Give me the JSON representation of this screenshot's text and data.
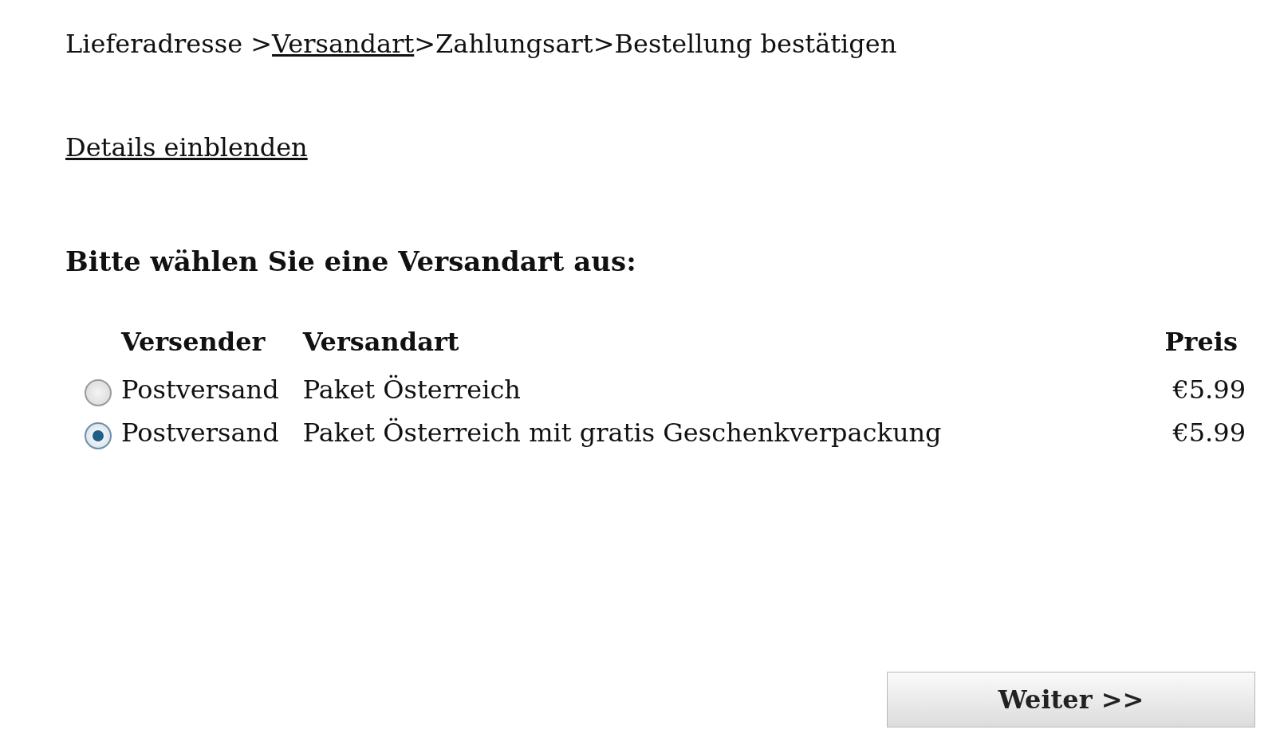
{
  "breadcrumb": [
    {
      "kind": "step",
      "label": "Lieferadresse",
      "selected": false
    },
    {
      "kind": "separator",
      "label": " >"
    },
    {
      "kind": "step",
      "label": "Versandart",
      "selected": true
    },
    {
      "kind": "separator",
      "label": ">"
    },
    {
      "kind": "step",
      "label": "Zahlungsart",
      "selected": false
    },
    {
      "kind": "separator",
      "label": ">"
    },
    {
      "kind": "step",
      "label": "Bestellung bestätigen",
      "selected": false
    }
  ],
  "details_link": "Details einblenden",
  "heading": "Bitte wählen Sie eine Versandart aus:",
  "table": {
    "columns": [
      "Versender",
      "Versandart",
      "Preis"
    ],
    "rows": [
      {
        "selected": false,
        "carrier": "Postversand",
        "method": "Paket Österreich",
        "price": "€5.99"
      },
      {
        "selected": true,
        "carrier": "Postversand",
        "method": "Paket Österreich mit gratis Geschenkverpackung",
        "price": "€5.99"
      }
    ]
  },
  "button": "Weiter >>"
}
